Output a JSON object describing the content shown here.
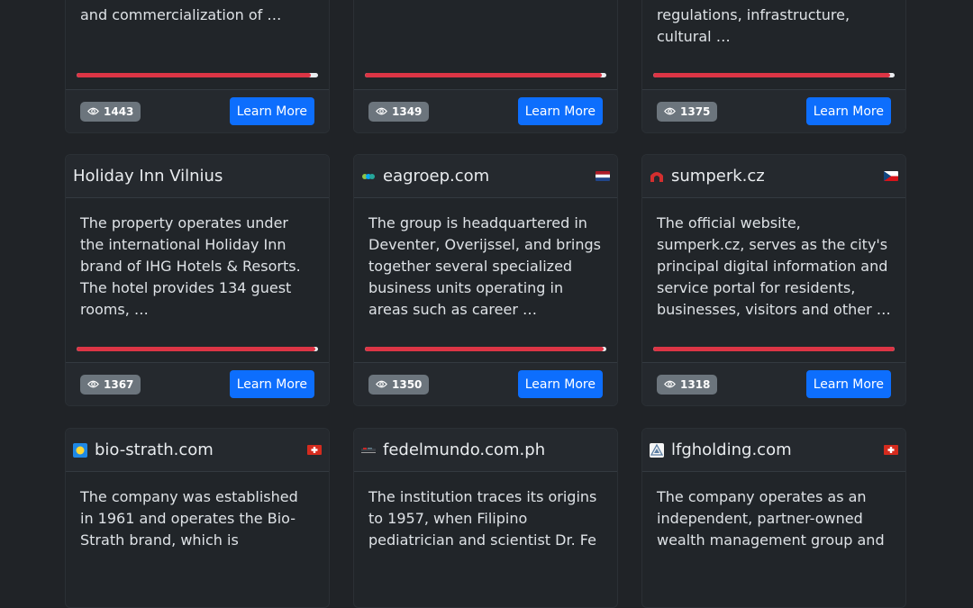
{
  "common": {
    "learn_more": "Learn More"
  },
  "row1": [
    {
      "desc_tail": "and commercialization of …",
      "views": "1443",
      "progress": 0.97
    },
    {
      "desc_tail": "",
      "views": "1349",
      "progress": 0.98
    },
    {
      "desc_tail": "regulations, infrastructure, cultural …",
      "views": "1375",
      "progress": 0.98
    }
  ],
  "row2": [
    {
      "title": "Holiday Inn Vilnius",
      "icon": "none",
      "flag": "none",
      "desc": "The property operates under the international Holiday Inn brand of IHG Hotels & Resorts. The hotel provides 134 guest rooms, …",
      "views": "1367",
      "progress": 0.99
    },
    {
      "title": "eagroep.com",
      "icon": "eagroep-logo-icon",
      "flag": "netherlands-flag",
      "desc": "The group is headquartered in Deventer, Overijssel, and brings together several specialized business units operating in areas such as career …",
      "views": "1350",
      "progress": 0.99
    },
    {
      "title": "sumperk.cz",
      "icon": "sumperk-logo-icon",
      "flag": "czech-flag",
      "desc": "The official website, sumperk.cz, serves as the city's principal digital information and service portal for residents, businesses, visitors and other …",
      "views": "1318",
      "progress": 1.0
    }
  ],
  "row3": [
    {
      "title": "bio-strath.com",
      "icon": "bio-strath-logo-icon",
      "flag": "swiss-flag",
      "desc": "The company was established in 1961 and operates the Bio-Strath brand, which is"
    },
    {
      "title": "fedelmundo.com.ph",
      "icon": "fedelmundo-logo-icon",
      "flag": "none",
      "desc": "The institution traces its origins to 1957, when Filipino pediatrician and scientist Dr. Fe"
    },
    {
      "title": "lfgholding.com",
      "icon": "lfgholding-logo-icon",
      "flag": "swiss-flag",
      "desc": "The company operates as an independent, partner-owned wealth management group and"
    }
  ],
  "colors": {
    "accent": "#0d6efd",
    "progress": "#dc3545",
    "badge": "#6c757d",
    "bg": "#202327"
  }
}
